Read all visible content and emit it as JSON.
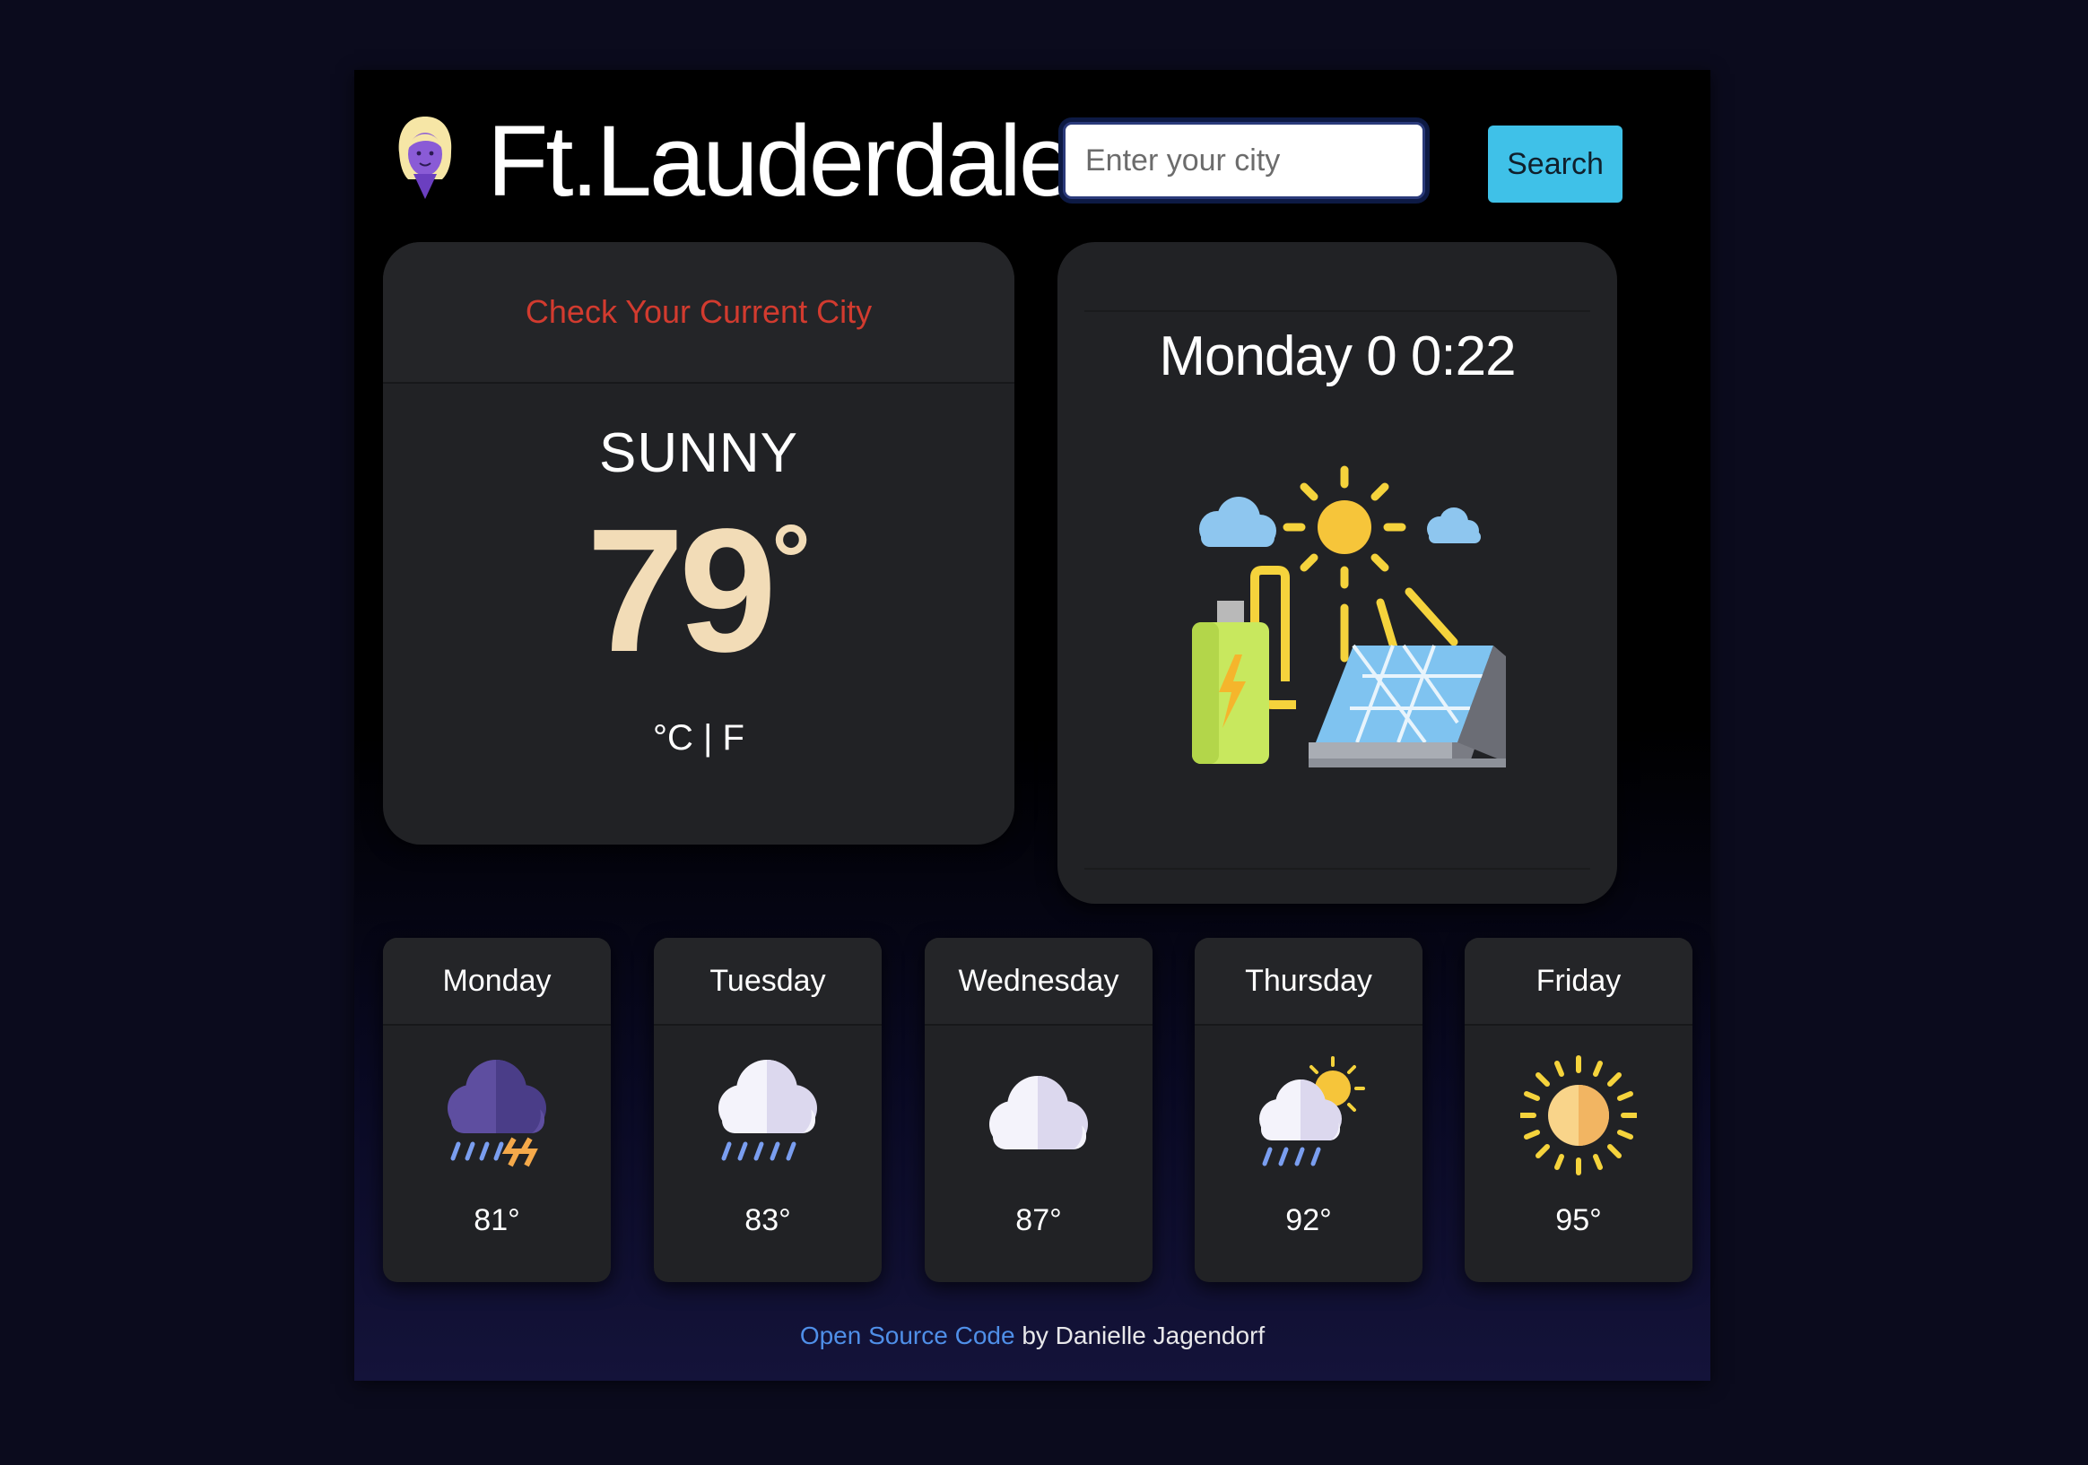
{
  "header": {
    "city_name": "Ft.Lauderdale",
    "logo_icon": "woman-avatar-icon"
  },
  "search": {
    "placeholder": "Enter your city",
    "value": "",
    "button_label": "Search"
  },
  "current": {
    "link_label": "Check Your Current City",
    "condition": "SUNNY",
    "temperature": "79",
    "degree_symbol": "°",
    "unit_celsius": "°C",
    "unit_separator": " | ",
    "unit_fahrenheit": "F"
  },
  "clock": {
    "day_time": "Monday 0 0:22",
    "illustration_icon": "solar-panel-battery-illustration"
  },
  "forecast": [
    {
      "day": "Monday",
      "temp": "81°",
      "icon": "thunderstorm-icon"
    },
    {
      "day": "Tuesday",
      "temp": "83°",
      "icon": "rain-icon"
    },
    {
      "day": "Wednesday",
      "temp": "87°",
      "icon": "cloud-icon"
    },
    {
      "day": "Thursday",
      "temp": "92°",
      "icon": "sun-cloud-rain-icon"
    },
    {
      "day": "Friday",
      "temp": "95°",
      "icon": "sun-icon"
    }
  ],
  "footer": {
    "link_label": "Open Source Code",
    "byline": " by Danielle Jagendorf"
  },
  "colors": {
    "page_background": "#0b0b1d",
    "card_background": "#212225",
    "accent_red": "#d23b2f",
    "temperature_cream": "#f2dcb7",
    "search_button": "#3fc1e8",
    "link_blue": "#4f8fe8"
  }
}
